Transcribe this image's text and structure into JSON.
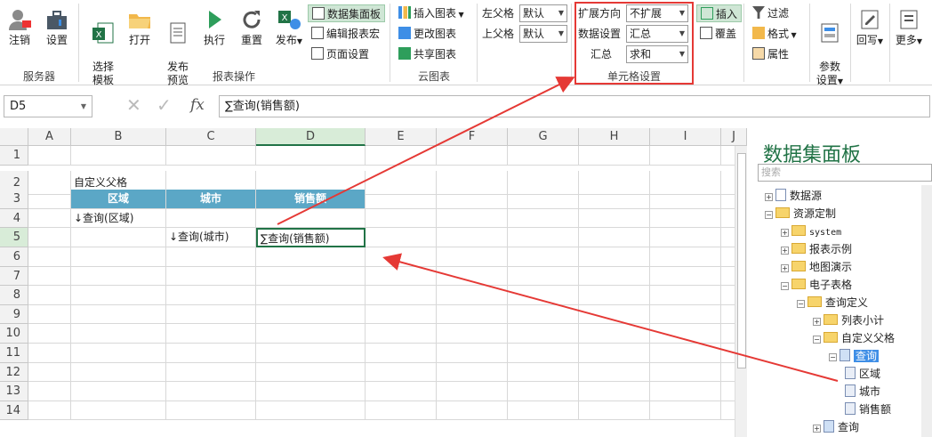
{
  "ribbon": {
    "btn_logout": "注销",
    "btn_settings": "设置",
    "grp_server": "服务器",
    "btn_select_tpl": "选择\n模板",
    "btn_open": "打开",
    "btn_preview": "发布\n预览",
    "btn_exec": "执行",
    "btn_reset": "重置",
    "btn_publish": "发布",
    "btn_dataset_panel": "数据集面板",
    "btn_edit_macro": "编辑报表宏",
    "btn_page_setup": "页面设置",
    "grp_report_ops": "报表操作",
    "btn_insert_chart": "插入图表",
    "btn_change_chart": "更改图表",
    "btn_share_chart": "共享图表",
    "grp_cloud_chart": "云图表",
    "left_parent_label": "左父格",
    "left_parent_value": "默认",
    "top_parent_label": "上父格",
    "top_parent_value": "默认",
    "expand_dir_label": "扩展方向",
    "expand_dir_value": "不扩展",
    "data_setting_label": "数据设置",
    "data_setting_value": "汇总",
    "summary_label": "汇总",
    "summary_value": "求和",
    "grp_cell_setting": "单元格设置",
    "btn_insert": "插入",
    "btn_overwrite": "覆盖",
    "btn_filter": "过滤",
    "btn_format": "格式",
    "btn_property": "属性",
    "btn_param_setting": "参数\n设置",
    "btn_writeback": "回写",
    "btn_more": "更多"
  },
  "formula_bar": {
    "name_box": "D5",
    "fx": "fx",
    "formula": "∑查询(销售额)"
  },
  "sheet": {
    "columns": [
      "A",
      "B",
      "C",
      "D",
      "E",
      "F",
      "G",
      "H",
      "I",
      "J"
    ],
    "rows": [
      "1",
      "2",
      "3",
      "4",
      "5",
      "6",
      "7",
      "8",
      "9",
      "10",
      "11",
      "12",
      "13",
      "14"
    ],
    "cells": {
      "B2": "自定义父格",
      "B3": "区域",
      "C3": "城市",
      "D3": "销售额",
      "B4": "↓查询(区域)",
      "C5": "↓查询(城市)",
      "D5": "∑查询(销售额)"
    }
  },
  "panel": {
    "title": "数据集面板",
    "search_placeholder": "搜索",
    "tree": [
      {
        "label": "数据源",
        "level": 0,
        "exp": "+",
        "type": "doc"
      },
      {
        "label": "资源定制",
        "level": 0,
        "exp": "-",
        "type": "folder"
      },
      {
        "label": "system",
        "level": 1,
        "exp": "+",
        "type": "folder"
      },
      {
        "label": "报表示例",
        "level": 1,
        "exp": "+",
        "type": "folder"
      },
      {
        "label": "地图演示",
        "level": 1,
        "exp": "+",
        "type": "folder"
      },
      {
        "label": "电子表格",
        "level": 1,
        "exp": "-",
        "type": "folder"
      },
      {
        "label": "查询定义",
        "level": 2,
        "exp": "-",
        "type": "folder"
      },
      {
        "label": "列表小计",
        "level": 3,
        "exp": "+",
        "type": "folder"
      },
      {
        "label": "自定义父格",
        "level": 3,
        "exp": "-",
        "type": "folder"
      },
      {
        "label": "查询",
        "level": 4,
        "exp": "-",
        "type": "query",
        "selected": true
      },
      {
        "label": "区域",
        "level": 5,
        "exp": "",
        "type": "field"
      },
      {
        "label": "城市",
        "level": 5,
        "exp": "",
        "type": "field"
      },
      {
        "label": "销售额",
        "level": 5,
        "exp": "",
        "type": "field"
      },
      {
        "label": "查询",
        "level": 3,
        "exp": "+",
        "type": "query2"
      }
    ]
  },
  "colors": {
    "header_fill": "#5ba7c6",
    "highlight_box": "#e53935",
    "selected_tree": "#3e8ee6",
    "accent_green": "#217346"
  }
}
